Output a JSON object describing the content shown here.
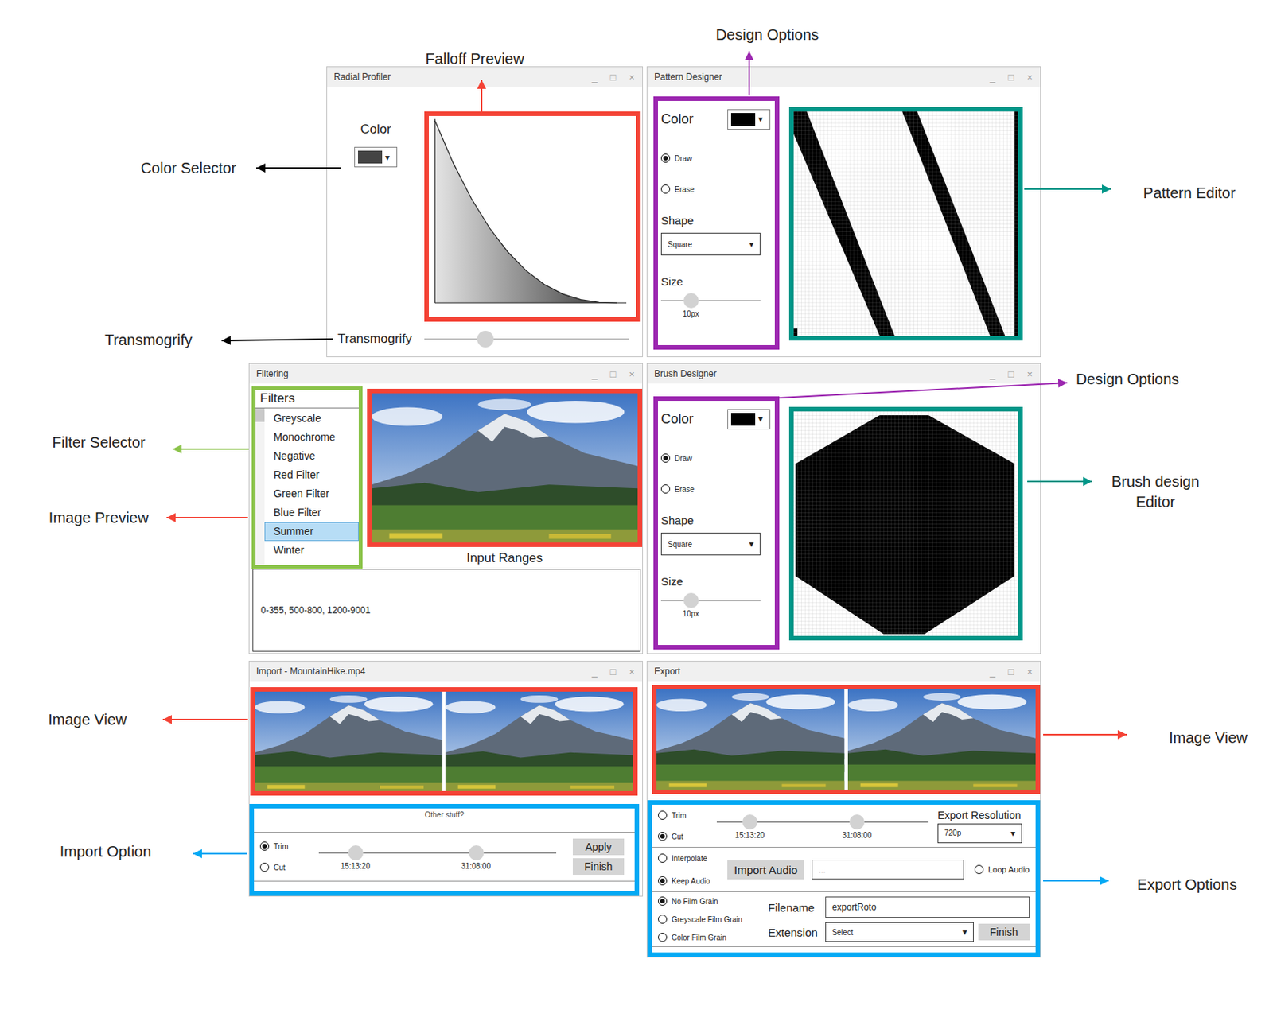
{
  "annotations": {
    "falloff_preview": {
      "label": "Falloff Preview",
      "color": "#f44336"
    },
    "design_options_pattern": {
      "label": "Design Options",
      "color": "#9c27b0"
    },
    "color_selector": {
      "label": "Color Selector",
      "color": "#000000"
    },
    "transmogrify": {
      "label": "Transmogrify",
      "color": "#000000"
    },
    "pattern_editor": {
      "label": "Pattern Editor",
      "color": "#009688"
    },
    "design_options_brush": {
      "label": "Design Options",
      "color": "#9c27b0"
    },
    "filter_selector": {
      "label": "Filter Selector",
      "color": "#8bc34a"
    },
    "image_preview": {
      "label": "Image Preview",
      "color": "#f44336"
    },
    "brush_editor": {
      "label": "Brush design Editor",
      "color": "#009688"
    },
    "import_image_view": {
      "label": "Image View",
      "color": "#f44336"
    },
    "import_option": {
      "label": "Import Option",
      "color": "#03a9f4"
    },
    "export_image_view": {
      "label": "Image View",
      "color": "#f44336"
    },
    "export_options": {
      "label": "Export Options",
      "color": "#03a9f4"
    }
  },
  "window_controls": [
    "_",
    "□",
    "×"
  ],
  "radial_profiler": {
    "title": "Radial Profiler",
    "color": {
      "label": "Color",
      "value": "#444444",
      "arrow": "▾"
    },
    "falloff": [
      1,
      0.768,
      0.572,
      0.41,
      0.279,
      0.177,
      0.101,
      0.049,
      0.018,
      0.003,
      0
    ],
    "slider": {
      "label": "Transmogrify",
      "level": 0.3
    }
  },
  "pattern_designer": {
    "title": "Pattern Designer",
    "color": {
      "label": "Color",
      "value": "#000000",
      "arrow": "▾"
    },
    "modes": [
      {
        "label": "Draw",
        "selected": true
      },
      {
        "label": "Erase",
        "selected": false
      }
    ],
    "shape": {
      "label": "Shape",
      "value": "Square",
      "arrow": "▾"
    },
    "size": {
      "label": "Size",
      "level": 0.3,
      "reading": "10px"
    }
  },
  "filtering": {
    "title": "Filtering",
    "list_label": "Filters",
    "filters": [
      {
        "label": "Greyscale",
        "selected": false
      },
      {
        "label": "Monochrome",
        "selected": false
      },
      {
        "label": "Negative",
        "selected": false
      },
      {
        "label": "Red Filter",
        "selected": false
      },
      {
        "label": "Green Filter",
        "selected": false
      },
      {
        "label": "Blue Filter",
        "selected": false
      },
      {
        "label": "Summer",
        "selected": true
      },
      {
        "label": "Winter",
        "selected": false
      }
    ],
    "ranges_label": "Input Ranges",
    "ranges_value": "0-355, 500-800, 1200-9001"
  },
  "brush_designer": {
    "title": "Brush Designer",
    "color": {
      "label": "Color",
      "value": "#000000",
      "arrow": "▾"
    },
    "modes": [
      {
        "label": "Draw",
        "selected": true
      },
      {
        "label": "Erase",
        "selected": false
      }
    ],
    "shape": {
      "label": "Shape",
      "value": "Square",
      "arrow": "▾"
    },
    "size": {
      "label": "Size",
      "level": 0.3,
      "reading": "10px"
    }
  },
  "import": {
    "title": "Import - MountainHike.mp4",
    "frames": 2,
    "note": "Other stuff?",
    "modes": [
      {
        "label": "Trim",
        "selected": true
      },
      {
        "label": "Cut",
        "selected": false
      }
    ],
    "range": {
      "low": 0.154,
      "high": 0.662,
      "low_label": "15:13:20",
      "high_label": "31:08:00"
    },
    "buttons": [
      "Apply",
      "Finish"
    ]
  },
  "export": {
    "title": "Export",
    "frames": 2,
    "trim_modes": [
      {
        "label": "Trim",
        "selected": false
      },
      {
        "label": "Cut",
        "selected": true
      }
    ],
    "range": {
      "low": 0.156,
      "high": 0.662,
      "low_label": "15:13:20",
      "high_label": "31:08:00"
    },
    "resolution": {
      "label": "Export Resolution",
      "value": "720p",
      "arrow": "▾"
    },
    "audio_modes": [
      {
        "label": "Interpolate",
        "selected": false
      },
      {
        "label": "Keep Audio",
        "selected": true
      }
    ],
    "import_audio": "Import Audio",
    "audio_file": "...",
    "loop_audio": {
      "label": "Loop Audio",
      "selected": false
    },
    "grain_modes": [
      {
        "label": "No Film Grain",
        "selected": true
      },
      {
        "label": "Greyscale Film Grain",
        "selected": false
      },
      {
        "label": "Color Film Grain",
        "selected": false
      }
    ],
    "filename": {
      "label": "Filename",
      "value": "exportRoto"
    },
    "extension": {
      "label": "Extension",
      "value": "Select",
      "arrow": "▾"
    },
    "finish": "Finish"
  }
}
